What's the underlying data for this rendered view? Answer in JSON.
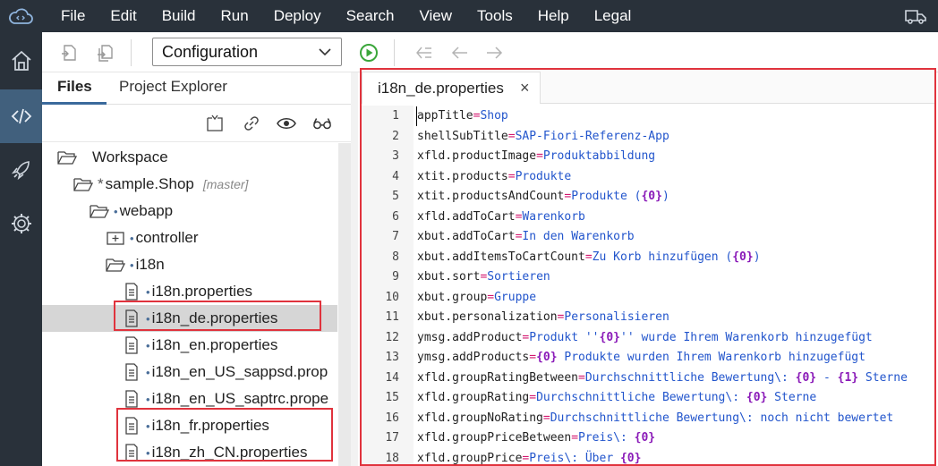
{
  "menu": [
    "File",
    "Edit",
    "Build",
    "Run",
    "Deploy",
    "Search",
    "View",
    "Tools",
    "Help",
    "Legal"
  ],
  "toolbar": {
    "config_label": "Configuration"
  },
  "left_tabs": [
    "Files",
    "Project Explorer"
  ],
  "tree": [
    {
      "label": "Workspace",
      "icon": "folder-open-icon",
      "prefix": "",
      "branch": ""
    },
    {
      "label": "sample.Shop",
      "icon": "folder-open-icon",
      "prefix": "*",
      "branch": "[master]"
    },
    {
      "label": "webapp",
      "icon": "folder-open-icon",
      "prefix": "•",
      "branch": ""
    },
    {
      "label": "controller",
      "icon": "folder-closed-icon",
      "prefix": "•",
      "branch": ""
    },
    {
      "label": "i18n",
      "icon": "folder-open-icon",
      "prefix": "•",
      "branch": ""
    },
    {
      "label": "i18n.properties",
      "icon": "file-icon",
      "prefix": "•",
      "branch": ""
    },
    {
      "label": "i18n_de.properties",
      "icon": "file-icon",
      "prefix": "•",
      "branch": ""
    },
    {
      "label": "i18n_en.properties",
      "icon": "file-icon",
      "prefix": "•",
      "branch": ""
    },
    {
      "label": "i18n_en_US_sappsd.prop",
      "icon": "file-icon",
      "prefix": "•",
      "branch": ""
    },
    {
      "label": "i18n_en_US_saptrc.prope",
      "icon": "file-icon",
      "prefix": "•",
      "branch": ""
    },
    {
      "label": "i18n_fr.properties",
      "icon": "file-icon",
      "prefix": "•",
      "branch": ""
    },
    {
      "label": "i18n_zh_CN.properties",
      "icon": "file-icon",
      "prefix": "•",
      "branch": ""
    }
  ],
  "editor": {
    "tab_label": "i18n_de.properties",
    "close_symbol": "×",
    "lines": [
      {
        "n": "1",
        "parts": [
          [
            "k",
            "appTitle"
          ],
          [
            "eq",
            "="
          ],
          [
            "v",
            "Shop"
          ]
        ]
      },
      {
        "n": "2",
        "parts": [
          [
            "k",
            "shellSubTitle"
          ],
          [
            "eq",
            "="
          ],
          [
            "v",
            "SAP-Fiori-Referenz-App"
          ]
        ]
      },
      {
        "n": "3",
        "parts": [
          [
            "k",
            "xfld.productImage"
          ],
          [
            "eq",
            "="
          ],
          [
            "v",
            "Produktabbildung"
          ]
        ]
      },
      {
        "n": "4",
        "parts": [
          [
            "k",
            "xtit.products"
          ],
          [
            "eq",
            "="
          ],
          [
            "v",
            "Produkte"
          ]
        ]
      },
      {
        "n": "5",
        "parts": [
          [
            "k",
            "xtit.productsAndCount"
          ],
          [
            "eq",
            "="
          ],
          [
            "v",
            "Produkte ("
          ],
          [
            "ph",
            "{0}"
          ],
          [
            "v",
            ")"
          ]
        ]
      },
      {
        "n": "6",
        "parts": [
          [
            "k",
            "xfld.addToCart"
          ],
          [
            "eq",
            "="
          ],
          [
            "v",
            "Warenkorb"
          ]
        ]
      },
      {
        "n": "7",
        "parts": [
          [
            "k",
            "xbut.addToCart"
          ],
          [
            "eq",
            "="
          ],
          [
            "v",
            "In den Warenkorb"
          ]
        ]
      },
      {
        "n": "8",
        "parts": [
          [
            "k",
            "xbut.addItemsToCartCount"
          ],
          [
            "eq",
            "="
          ],
          [
            "v",
            "Zu Korb hinzufügen ("
          ],
          [
            "ph",
            "{0}"
          ],
          [
            "v",
            ")"
          ]
        ]
      },
      {
        "n": "9",
        "parts": [
          [
            "k",
            "xbut.sort"
          ],
          [
            "eq",
            "="
          ],
          [
            "v",
            "Sortieren"
          ]
        ]
      },
      {
        "n": "10",
        "parts": [
          [
            "k",
            "xbut.group"
          ],
          [
            "eq",
            "="
          ],
          [
            "v",
            "Gruppe"
          ]
        ]
      },
      {
        "n": "11",
        "parts": [
          [
            "k",
            "xbut.personalization"
          ],
          [
            "eq",
            "="
          ],
          [
            "v",
            "Personalisieren"
          ]
        ]
      },
      {
        "n": "12",
        "parts": [
          [
            "k",
            "ymsg.addProduct"
          ],
          [
            "eq",
            "="
          ],
          [
            "v",
            "Produkt ''"
          ],
          [
            "ph",
            "{0}"
          ],
          [
            "v",
            "'' wurde Ihrem Warenkorb hinzugefügt"
          ]
        ]
      },
      {
        "n": "13",
        "parts": [
          [
            "k",
            "ymsg.addProducts"
          ],
          [
            "eq",
            "="
          ],
          [
            "ph",
            "{0}"
          ],
          [
            "v",
            " Produkte wurden Ihrem Warenkorb hinzugefügt"
          ]
        ]
      },
      {
        "n": "14",
        "parts": [
          [
            "k",
            "xfld.groupRatingBetween"
          ],
          [
            "eq",
            "="
          ],
          [
            "v",
            "Durchschnittliche Bewertung\\: "
          ],
          [
            "ph",
            "{0}"
          ],
          [
            "v",
            " - "
          ],
          [
            "ph",
            "{1}"
          ],
          [
            "v",
            " Sterne"
          ]
        ]
      },
      {
        "n": "15",
        "parts": [
          [
            "k",
            "xfld.groupRating"
          ],
          [
            "eq",
            "="
          ],
          [
            "v",
            "Durchschnittliche Bewertung\\: "
          ],
          [
            "ph",
            "{0}"
          ],
          [
            "v",
            " Sterne"
          ]
        ]
      },
      {
        "n": "16",
        "parts": [
          [
            "k",
            "xfld.groupNoRating"
          ],
          [
            "eq",
            "="
          ],
          [
            "v",
            "Durchschnittliche Bewertung\\: noch nicht bewertet"
          ]
        ]
      },
      {
        "n": "17",
        "parts": [
          [
            "k",
            "xfld.groupPriceBetween"
          ],
          [
            "eq",
            "="
          ],
          [
            "v",
            "Preis\\: "
          ],
          [
            "ph",
            "{0}"
          ]
        ]
      },
      {
        "n": "18",
        "parts": [
          [
            "k",
            "xfld.groupPrice"
          ],
          [
            "eq",
            "="
          ],
          [
            "v",
            "Preis\\: Über "
          ],
          [
            "ph",
            "{0}"
          ]
        ]
      }
    ]
  },
  "colors": {
    "menubar": "#29313a",
    "activity_active": "#41607d",
    "highlight_box": "#e0333d",
    "run_green": "#3aa63a"
  }
}
